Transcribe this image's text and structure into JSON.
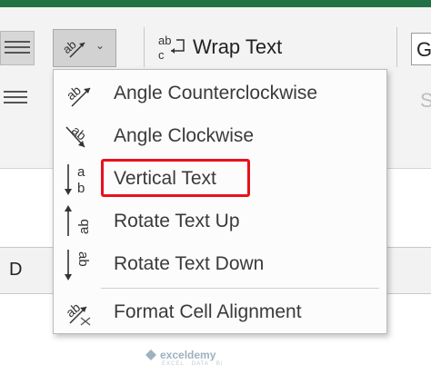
{
  "ribbon": {
    "wrap_text_label": "Wrap Text",
    "font_box_partial": "G",
    "partial_glyph": "S",
    "orientation_button_icon": "orientation-ab-diagonal-icon"
  },
  "sheet": {
    "column_header": "D"
  },
  "orientation_menu": {
    "items": [
      {
        "label": "Angle Counterclockwise",
        "icon": "angle-counterclockwise-icon"
      },
      {
        "label": "Angle Clockwise",
        "icon": "angle-clockwise-icon"
      },
      {
        "label": "Vertical Text",
        "icon": "vertical-text-icon",
        "highlighted": true
      },
      {
        "label": "Rotate Text Up",
        "icon": "rotate-text-up-icon"
      },
      {
        "label": "Rotate Text Down",
        "icon": "rotate-text-down-icon"
      },
      {
        "label": "Format Cell Alignment",
        "icon": "format-cell-alignment-icon"
      }
    ]
  },
  "watermark": {
    "brand": "exceldemy",
    "tagline": "EXCEL · DATA · BI"
  },
  "colors": {
    "excel_green": "#217346",
    "highlight_red": "#e8101b"
  }
}
